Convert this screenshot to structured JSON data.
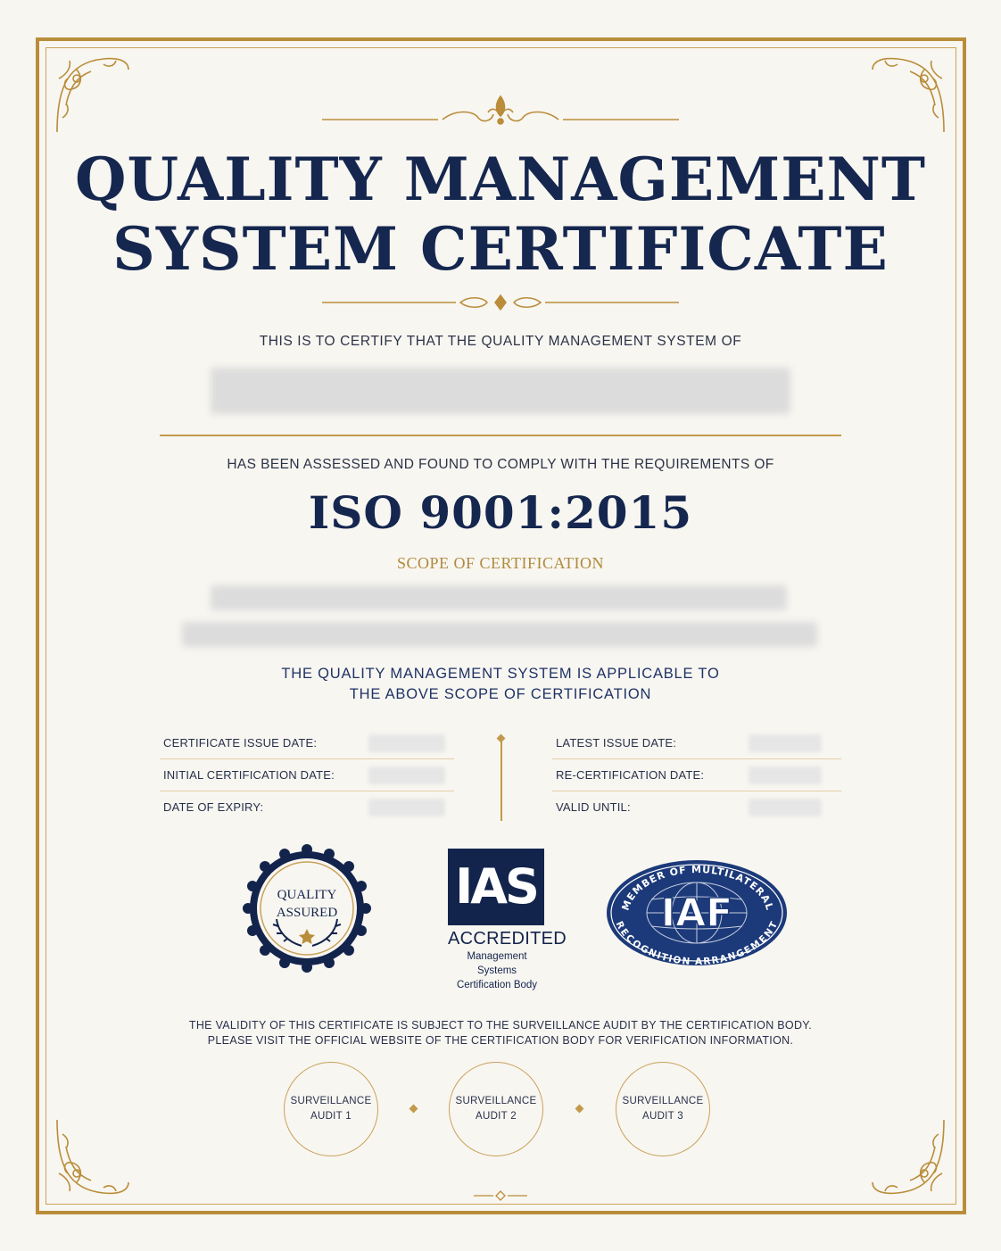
{
  "certificate": {
    "title_line1": "QUALITY MANAGEMENT",
    "title_line2": "SYSTEM CERTIFICATE",
    "certify_text": "THIS IS TO CERTIFY THAT THE QUALITY MANAGEMENT SYSTEM OF",
    "assessed_text": "HAS BEEN ASSESSED AND FOUND TO COMPLY WITH THE REQUIREMENTS OF",
    "standard": "ISO 9001:2015",
    "scope_label": "SCOPE OF CERTIFICATION",
    "applicable_line1": "THE QUALITY MANAGEMENT SYSTEM IS APPLICABLE TO",
    "applicable_line2": "THE ABOVE SCOPE OF CERTIFICATION"
  },
  "dates": {
    "left": [
      {
        "label": "CERTIFICATE ISSUE DATE:"
      },
      {
        "label": "INITIAL CERTIFICATION DATE:"
      },
      {
        "label": "DATE OF EXPIRY:"
      }
    ],
    "right": [
      {
        "label": "LATEST ISSUE DATE:"
      },
      {
        "label": "RE-CERTIFICATION DATE:"
      },
      {
        "label": "VALID UNTIL:"
      }
    ]
  },
  "logos": {
    "seal_line1": "QUALITY",
    "seal_line2": "ASSURED",
    "ias_mark": "IAS",
    "ias_accredited": "ACCREDITED",
    "ias_sub1": "Management Systems",
    "ias_sub2": "Certification Body",
    "iaf_mark": "IAF",
    "iaf_top_arc": "MEMBER OF MULTILATERAL",
    "iaf_bottom_arc": "RECOGNITION ARRANGEMENT"
  },
  "footer": {
    "validity_line1": "THE VALIDITY OF THIS CERTIFICATE IS SUBJECT TO THE SURVEILLANCE AUDIT BY THE CERTIFICATION BODY.",
    "validity_line2": "PLEASE VISIT THE OFFICIAL WEBSITE OF THE CERTIFICATION BODY FOR VERIFICATION INFORMATION.",
    "audits": [
      {
        "line1": "SURVEILLANCE",
        "line2": "AUDIT 1"
      },
      {
        "line1": "SURVEILLANCE",
        "line2": "AUDIT 2"
      },
      {
        "line1": "SURVEILLANCE",
        "line2": "AUDIT 3"
      }
    ]
  },
  "colors": {
    "navy": "#15274f",
    "gold": "#b98d3a",
    "paper": "#f8f6f1"
  },
  "icons": [
    "corner-flourish-icon",
    "top-ornament-icon",
    "divider-ornament-icon",
    "laurel-icon",
    "star-icon",
    "globe-icon"
  ]
}
